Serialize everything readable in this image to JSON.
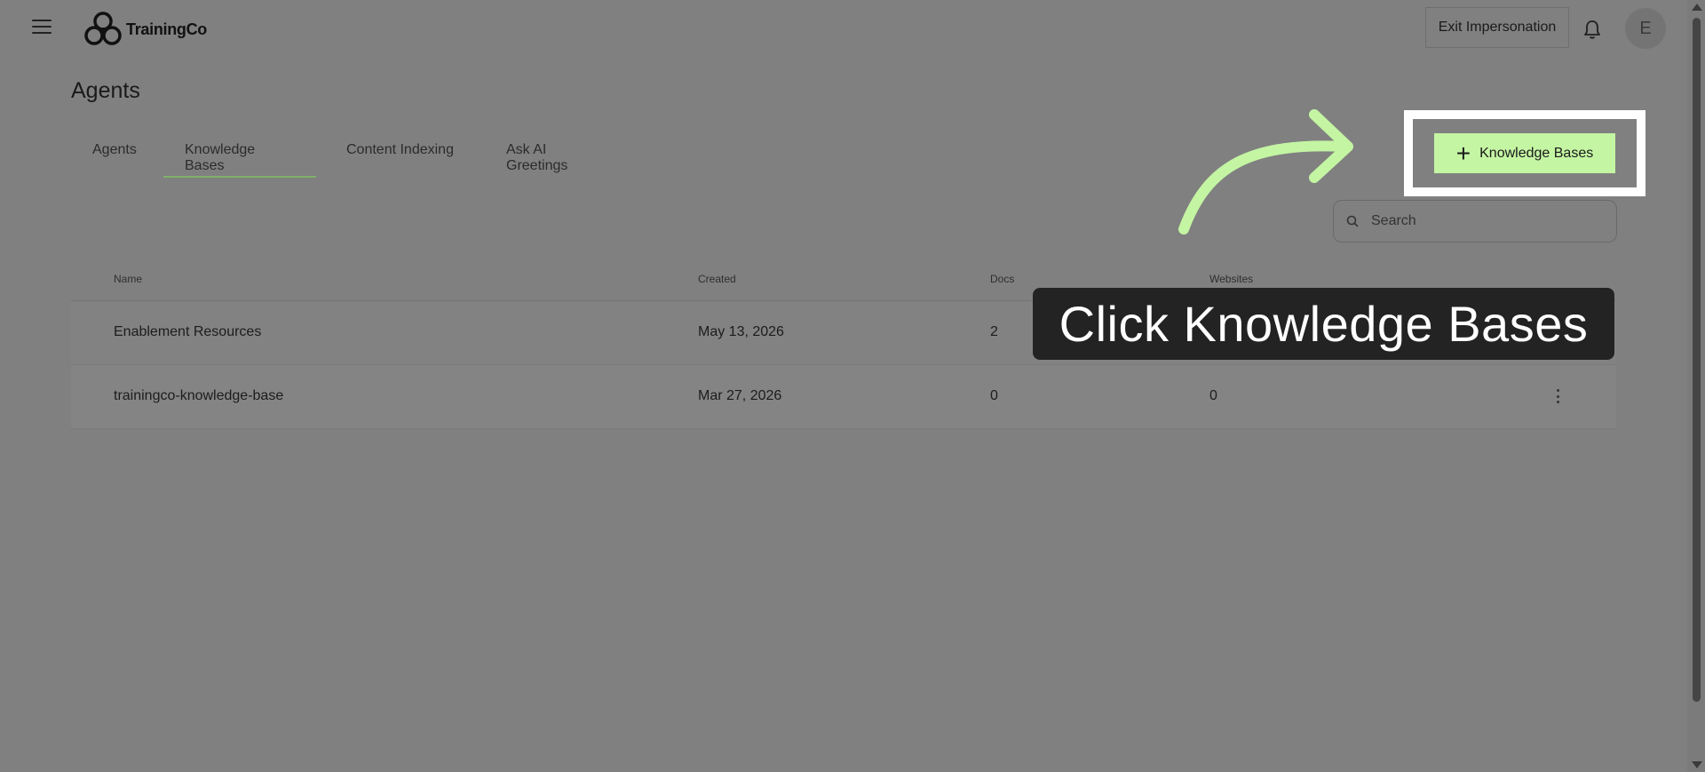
{
  "header": {
    "brand": "TrainingCo",
    "exit_impersonation_label": "Exit Impersonation",
    "avatar_initial": "E"
  },
  "page": {
    "title": "Agents"
  },
  "tabs": [
    {
      "label": "Agents"
    },
    {
      "label": "Knowledge Bases",
      "active": true
    },
    {
      "label": "Content Indexing"
    },
    {
      "label": "Ask AI Greetings"
    }
  ],
  "toolbar": {
    "add_button_label": "Knowledge Bases"
  },
  "search": {
    "placeholder": "Search"
  },
  "table": {
    "columns": [
      "Name",
      "Created",
      "Docs",
      "Websites"
    ],
    "rows": [
      {
        "name": "Enablement Resources",
        "created": "May 13, 2026",
        "docs": "2",
        "websites": ""
      },
      {
        "name": "trainingco-knowledge-base",
        "created": "Mar 27, 2026",
        "docs": "0",
        "websites": "0"
      }
    ]
  },
  "callout": {
    "text": "Click Knowledge Bases"
  },
  "colors": {
    "overlay_bg": "#808080",
    "highlight_green": "#c4f5a3",
    "arrow_green": "#c4f5a3",
    "callout_bg": "#232323",
    "tab_underline": "#7fb06a"
  },
  "icons": {
    "menu": "hamburger-icon",
    "bell": "bell-icon",
    "search": "search-icon",
    "plus": "plus-icon",
    "more": "more-vertical-icon"
  }
}
